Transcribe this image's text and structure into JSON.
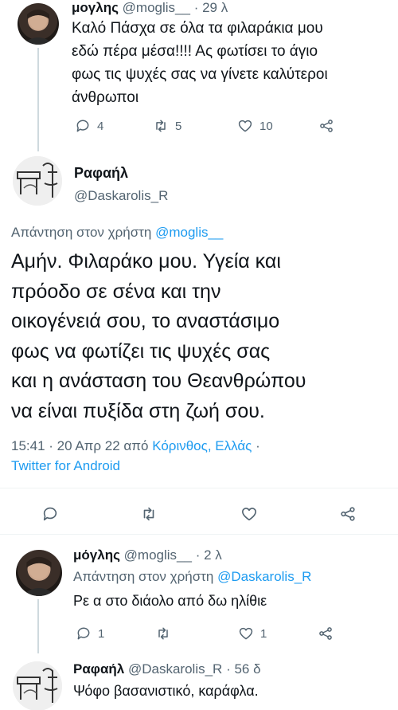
{
  "top_tweet": {
    "name": "μογλης",
    "handle": "@moglis__",
    "time": "· 29 λ",
    "text_lines": [
      "Καλό Πάσχα σε όλα τα φιλαράκια μου",
      "εδώ πέρα μέσα!!!! Ας φωτίσει το άγιο",
      "φως τις ψυχές σας να γίνετε καλύτεροι",
      "άνθρωποι"
    ],
    "replies": "4",
    "retweets": "5",
    "likes": "10"
  },
  "main_tweet": {
    "name": "Ραφαήλ",
    "handle": "@Daskarolis_R",
    "reply_prefix": "Απάντηση στον χρήστη",
    "reply_to": "@moglis__",
    "text_lines": [
      "Αμήν. Φιλαράκο μου. Υγεία και",
      "πρόοδο σε σένα και την",
      "οικογένειά σου, το αναστάσιμο",
      "φως να φωτίζει τις ψυχές σας",
      "και η ανάσταση του Θεανθρώπου",
      "να είναι πυξίδα στη ζωή σου."
    ],
    "meta_time": "15:41 · 20 Απρ 22 από",
    "meta_place": "Κόρινθος, Ελλάς",
    "meta_dot": "·",
    "meta_client": "Twitter for Android"
  },
  "reply_1": {
    "name": "μόγλης",
    "handle": "@moglis__",
    "time": "· 2 λ",
    "reply_prefix": "Απάντηση στον χρήστη",
    "reply_to": "@Daskarolis_R",
    "text": "Ρε α στο διάολο από δω ηλίθιε",
    "replies": "1",
    "likes": "1"
  },
  "reply_2": {
    "name": "Ραφαήλ",
    "handle": "@Daskarolis_R",
    "time": "· 56 δ",
    "text": "Ψόφο βασανιστικό, καράφλα."
  },
  "icons": [
    "reply-icon",
    "retweet-icon",
    "like-icon",
    "share-icon"
  ],
  "colors": {
    "link": "#1d9bf0",
    "muted": "#536471",
    "text": "#0f1419"
  }
}
